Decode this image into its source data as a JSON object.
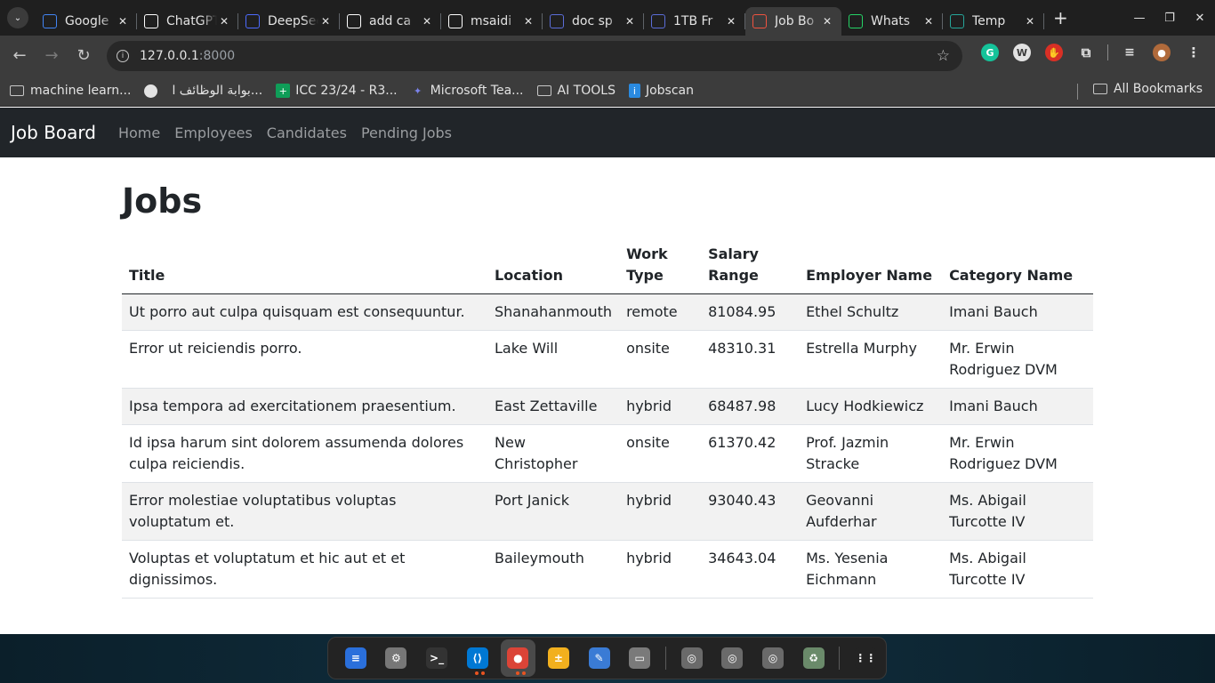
{
  "browser": {
    "tabs": [
      {
        "title": "Google",
        "icon": "google-docs-icon",
        "color": "#4285f4"
      },
      {
        "title": "ChatGPT",
        "icon": "chatgpt-icon",
        "color": "#ffffff"
      },
      {
        "title": "DeepSeek",
        "icon": "deepseek-icon",
        "color": "#4d6bfe"
      },
      {
        "title": "add ca",
        "icon": "github-icon",
        "color": "#ffffff"
      },
      {
        "title": "msaidi",
        "icon": "github-icon",
        "color": "#ffffff"
      },
      {
        "title": "doc sp",
        "icon": "doc-icon",
        "color": "#5b6dd8"
      },
      {
        "title": "1TB Fr",
        "icon": "doc-icon",
        "color": "#5b6dd8"
      },
      {
        "title": "Job Bo",
        "icon": "laravel-icon",
        "color": "#f05340"
      },
      {
        "title": "Whats",
        "icon": "whatsapp-icon",
        "color": "#25d366"
      },
      {
        "title": "Temp",
        "icon": "temp-icon",
        "color": "#26a69a"
      }
    ],
    "active_tab_index": 7,
    "url_host": "127.0.0.1",
    "url_port": ":8000",
    "bookmarks": [
      {
        "label": "machine learn...",
        "icon": "folder-icon"
      },
      {
        "label": "بوابة الوظائف ا...",
        "icon": "globe-icon"
      },
      {
        "label": "ICC 23/24 - R3...",
        "icon": "sheets-icon"
      },
      {
        "label": "Microsoft Tea...",
        "icon": "teams-icon"
      },
      {
        "label": "AI TOOLS",
        "icon": "folder-icon"
      },
      {
        "label": "Jobscan",
        "icon": "jobscan-icon"
      }
    ],
    "all_bookmarks": "All Bookmarks"
  },
  "app": {
    "brand": "Job Board",
    "nav": [
      "Home",
      "Employees",
      "Candidates",
      "Pending Jobs"
    ],
    "page_title": "Jobs",
    "columns": [
      "Title",
      "Location",
      "Work Type",
      "Salary Range",
      "Employer Name",
      "Category Name"
    ],
    "rows": [
      [
        "Ut porro aut culpa quisquam est consequuntur.",
        "Shanahanmouth",
        "remote",
        "81084.95",
        "Ethel Schultz",
        "Imani Bauch"
      ],
      [
        "Error ut reiciendis porro.",
        "Lake Will",
        "onsite",
        "48310.31",
        "Estrella Murphy",
        "Mr. Erwin Rodriguez DVM"
      ],
      [
        "Ipsa tempora ad exercitationem praesentium.",
        "East Zettaville",
        "hybrid",
        "68487.98",
        "Lucy Hodkiewicz",
        "Imani Bauch"
      ],
      [
        "Id ipsa harum sint dolorem assumenda dolores culpa reiciendis.",
        "New Christopher",
        "onsite",
        "61370.42",
        "Prof. Jazmin Stracke",
        "Mr. Erwin Rodriguez DVM"
      ],
      [
        "Error molestiae voluptatibus voluptas voluptatum et.",
        "Port Janick",
        "hybrid",
        "93040.43",
        "Geovanni Aufderhar",
        "Ms. Abigail Turcotte IV"
      ],
      [
        "Voluptas et voluptatum et hic aut et et dignissimos.",
        "Baileymouth",
        "hybrid",
        "34643.04",
        "Ms. Yesenia Eichmann",
        "Ms. Abigail Turcotte IV"
      ]
    ]
  },
  "dock": [
    {
      "name": "text-editor-icon",
      "color": "#2a6fdb",
      "glyph": "≡"
    },
    {
      "name": "settings-icon",
      "color": "#777777",
      "glyph": "⚙"
    },
    {
      "name": "terminal-icon",
      "color": "#333333",
      "glyph": ">_"
    },
    {
      "name": "vscode-icon",
      "color": "#0078d4",
      "glyph": "⟨⟩"
    },
    {
      "name": "chrome-icon",
      "color": "#db4437",
      "glyph": "●"
    },
    {
      "name": "calculator-icon",
      "color": "#f2b01e",
      "glyph": "±"
    },
    {
      "name": "notes-icon",
      "color": "#3a7bd5",
      "glyph": "✎"
    },
    {
      "name": "files-icon",
      "color": "#7a7a7a",
      "glyph": "▭"
    },
    {
      "name": "disk-icon",
      "color": "#6a6a6a",
      "glyph": "◎"
    },
    {
      "name": "disk-icon",
      "color": "#6a6a6a",
      "glyph": "◎"
    },
    {
      "name": "disk-icon",
      "color": "#6a6a6a",
      "glyph": "◎"
    },
    {
      "name": "trash-icon",
      "color": "#6a8a6a",
      "glyph": "♻"
    },
    {
      "name": "app-grid-icon",
      "color": "#232323",
      "glyph": "⋮⋮"
    }
  ]
}
